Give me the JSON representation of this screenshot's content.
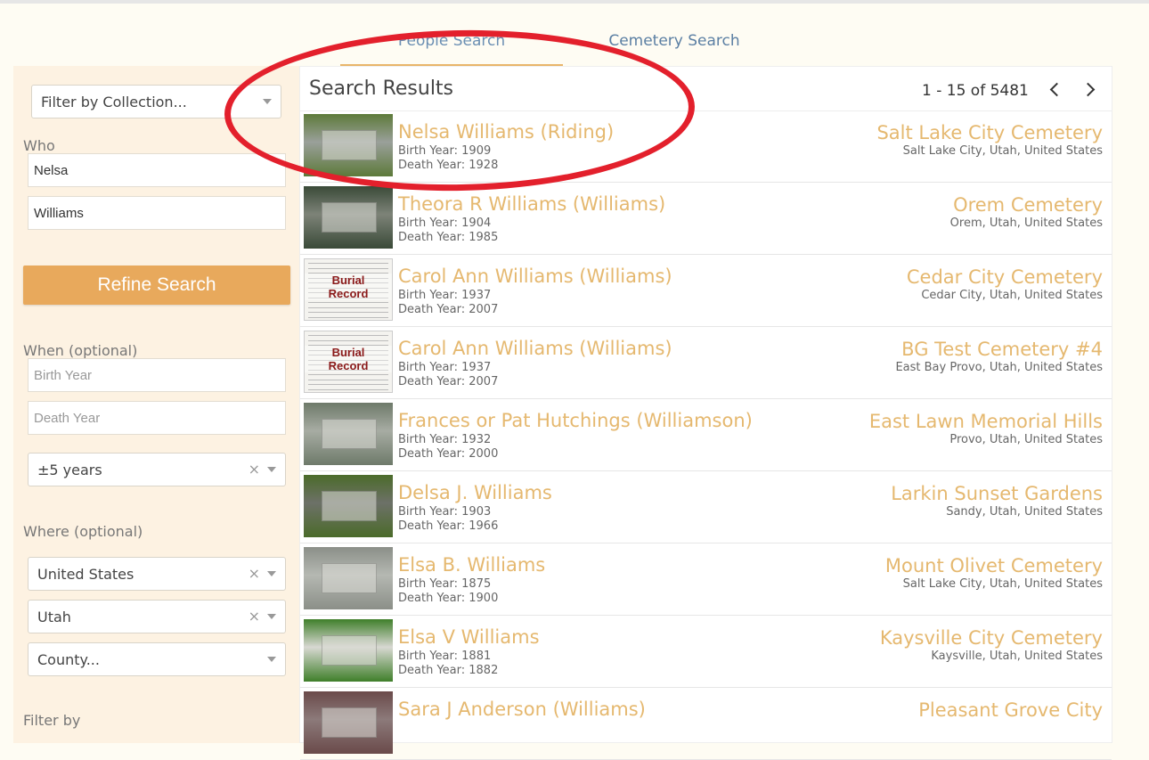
{
  "tabs": {
    "people": "People Search",
    "cemetery": "Cemetery Search"
  },
  "sidebar": {
    "collection_placeholder": "Filter by Collection...",
    "who_label": "Who",
    "first_name": "Nelsa",
    "last_name": "Williams",
    "refine_label": "Refine Search",
    "when_label": "When (optional)",
    "birth_placeholder": "Birth Year",
    "death_placeholder": "Death Year",
    "range_value": "±5 years",
    "where_label": "Where (optional)",
    "country": "United States",
    "state": "Utah",
    "county_placeholder": "County...",
    "filter_label": "Filter by",
    "clear_glyph": "×"
  },
  "results": {
    "title": "Search Results",
    "pager": "1 - 15 of 5481",
    "rows": [
      {
        "name": "Nelsa Williams (Riding)",
        "birth": "Birth Year: 1909",
        "death": "Death Year: 1928",
        "cemetery": "Salt Lake City Cemetery",
        "location": "Salt Lake City, Utah, United States",
        "thumb": "stone"
      },
      {
        "name": "Theora R Williams (Williams)",
        "birth": "Birth Year: 1904",
        "death": "Death Year: 1985",
        "cemetery": "Orem Cemetery",
        "location": "Orem, Utah, United States",
        "thumb": "stone"
      },
      {
        "name": "Carol Ann Williams (Williams)",
        "birth": "Birth Year: 1937",
        "death": "Death Year: 2007",
        "cemetery": "Cedar City Cemetery",
        "location": "Cedar City, Utah, United States",
        "thumb": "record"
      },
      {
        "name": "Carol Ann Williams (Williams)",
        "birth": "Birth Year: 1937",
        "death": "Death Year: 2007",
        "cemetery": "BG Test Cemetery #4",
        "location": "East Bay Provo, Utah, United States",
        "thumb": "record"
      },
      {
        "name": "Frances or Pat Hutchings (Williamson)",
        "birth": "Birth Year: 1932",
        "death": "Death Year: 2000",
        "cemetery": "East Lawn Memorial Hills",
        "location": "Provo, Utah, United States",
        "thumb": "stone"
      },
      {
        "name": "Delsa J. Williams",
        "birth": "Birth Year: 1903",
        "death": "Death Year: 1966",
        "cemetery": "Larkin Sunset Gardens",
        "location": "Sandy, Utah, United States",
        "thumb": "stone"
      },
      {
        "name": "Elsa B. Williams",
        "birth": "Birth Year: 1875",
        "death": "Death Year: 1900",
        "cemetery": "Mount Olivet Cemetery",
        "location": "Salt Lake City, Utah, United States",
        "thumb": "stone"
      },
      {
        "name": "Elsa V Williams",
        "birth": "Birth Year: 1881",
        "death": "Death Year: 1882",
        "cemetery": "Kaysville City Cemetery",
        "location": "Kaysville, Utah, United States",
        "thumb": "stone"
      },
      {
        "name": "Sara J Anderson (Williams)",
        "birth": "",
        "death": "",
        "cemetery": "Pleasant Grove City",
        "location": "",
        "thumb": "stone"
      }
    ],
    "record_thumb_text": [
      "Burial",
      "Record"
    ]
  }
}
